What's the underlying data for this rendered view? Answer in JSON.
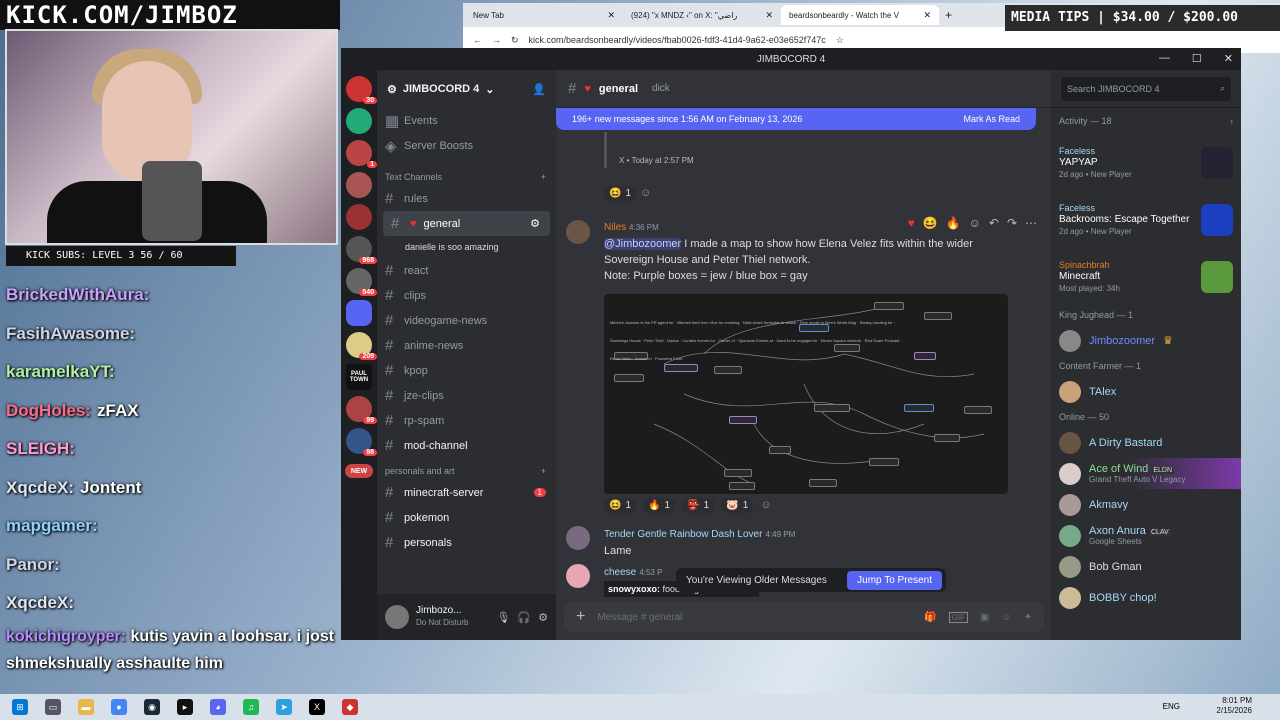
{
  "overlay": {
    "brand": "KICK.COM/JIMBOZ",
    "media": "MEDIA TIPS | $34.00 / $200.00",
    "subs": "KICK SUBS: LEVEL 3 56 / 60"
  },
  "browser": {
    "tabs": [
      {
        "label": "New Tab"
      },
      {
        "label": "(924) \"x MNDZ ‹\" on X: \"راضي"
      },
      {
        "label": "beardsonbeardly - Watch the V"
      }
    ],
    "url": "kick.com/beardsonbeardly/videos/fbab0026-fdf3-41d4-9a62-e03e652f747c",
    "marks": "marks"
  },
  "chat": [
    {
      "u": "BrickedWithAura:",
      "t": ""
    },
    {
      "u": "FasihAwasome:",
      "t": ""
    },
    {
      "u": "karamelkaYT:",
      "t": ""
    },
    {
      "u": "DogHoles:",
      "t": "zFAX"
    },
    {
      "u": "SLEIGH:",
      "t": ""
    },
    {
      "u": "XqcdeX:",
      "t": "Jontent"
    },
    {
      "u": "mapgamer:",
      "t": ""
    },
    {
      "u": "Panor:",
      "t": ""
    },
    {
      "u": "XqcdeX:",
      "t": ""
    }
  ],
  "chat_last": {
    "u": "kokichigroyper:",
    "t": "kutis yavin a loohsar. i jost shmekshually asshaulte him"
  },
  "discord": {
    "window_title": "JIMBOCORD 4",
    "server": "JIMBOCORD 4",
    "top_items": [
      "Events",
      "Server Boosts"
    ],
    "cat_text": "Text Channels",
    "channels": [
      "rules",
      "general",
      "react",
      "clips",
      "videogame-news",
      "anime-news",
      "kpop",
      "jze-clips",
      "rp-spam",
      "mod-channel"
    ],
    "sub_thread": "danielle is soo amazing",
    "cat2": "personals and art",
    "channels2": [
      "minecraft-server",
      "pokemon",
      "personals"
    ],
    "mc_badge": "1",
    "guild_badges": [
      "30",
      "1",
      "968",
      "540",
      "209",
      "99",
      "98",
      "NEW"
    ],
    "guild_label": "PAUL TOWN",
    "user": {
      "name": "Jimbozo...",
      "status": "Do Not Disturb"
    },
    "header": {
      "channel": "general",
      "topic": "dick"
    },
    "newbar": {
      "text": "196+ new messages since 1:56 AM on February 13, 2026",
      "action": "Mark As Read"
    },
    "embed_meta": "X • Today at 2:57 PM",
    "reaction_count": "1",
    "msg1": {
      "author": "Niles",
      "time": "4:36 PM",
      "mention": "@Jimbozoomer",
      "line1": " I made a map to show how Elena Velez fits within the wider",
      "line2": "Sovereign House and Peter Thiel network.",
      "line3": "Note: Purple boxes = jew / blue box = gay"
    },
    "msg1_reactions": [
      "1",
      "1",
      "1",
      "1"
    ],
    "msg2": {
      "author": "Tender Gentle Rainbow Dash Lover",
      "time": "4:49 PM",
      "text": "Lame"
    },
    "msg3": {
      "author": "cheese",
      "time": "4:53 P",
      "reply_user": "snowyxoxo:",
      "reply_text": "foods high in animal fat"
    },
    "older": {
      "text": "You're Viewing Older Messages",
      "action": "Jump To Present"
    },
    "composer": "Message #  general",
    "search": "Search JIMBOCORD 4",
    "activity": "Activity — 18",
    "activities": [
      {
        "user": "Faceless",
        "game": "YAPYAP",
        "meta": "2d ago • New Player"
      },
      {
        "user": "Faceless",
        "game": "Backrooms: Escape Together",
        "meta": "2d ago • New Player"
      },
      {
        "user": "Spinachbrah",
        "game": "Minecraft",
        "meta": "Most played: 34h"
      }
    ],
    "role1": "King Jughead — 1",
    "role1_member": "Jimbozoomer",
    "role2": "Content Farmer  — 1",
    "role2_member": "TAlex",
    "online": "Online — 50",
    "members": [
      {
        "n": "A Dirty Bastard",
        "s": ""
      },
      {
        "n": "Ace of Wind",
        "s": "Grand Theft Auto V Legacy",
        "tag": "ELDN"
      },
      {
        "n": "Akmavy",
        "s": ""
      },
      {
        "n": "Axon Anura",
        "s": "Google Sheets",
        "tag": "CLAV"
      },
      {
        "n": "Bob Gman",
        "s": ""
      },
      {
        "n": "BOBBY chop!",
        "s": ""
      }
    ],
    "map_labels": [
      "Mitchell Jackson is the PR agent for",
      "Mitchell fired from Vice for emailing",
      "Nikki which feminists to attack",
      "Free model in Men's World Mag",
      "Startup funding for",
      "Sovereign House",
      "Peter Thiel",
      "Dasha",
      "Curates events for",
      "Owner of",
      "Sponsors Events at",
      "Used to be engaged to",
      "Dimes Square network",
      "Red Scare Podcast",
      "Elena Velez",
      "Invests in",
      "Founders Fund"
    ]
  },
  "taskbar": {
    "lang": "ENG",
    "time": "8:01 PM",
    "date": "2/15/2026"
  }
}
